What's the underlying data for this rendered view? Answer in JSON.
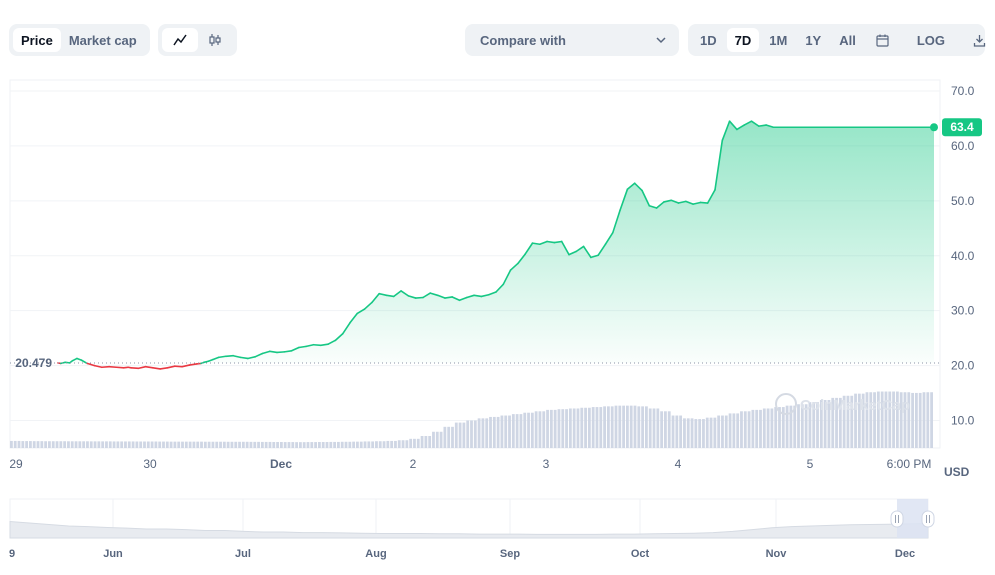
{
  "toolbar": {
    "data_tabs": [
      "Price",
      "Market cap"
    ],
    "active_data_tab": "Price",
    "chart_type_icons": [
      "line-chart-icon",
      "candlestick-icon"
    ],
    "compare_label": "Compare with",
    "ranges": [
      "1D",
      "7D",
      "1M",
      "1Y",
      "All"
    ],
    "active_range": "7D",
    "calendar_icon": "calendar-icon",
    "log_label": "LOG",
    "download_icon": "download-icon"
  },
  "colors": {
    "up": "#16c784",
    "down": "#ea3943",
    "volume": "#cfd6e4",
    "selector": "#dce3f2"
  },
  "watermark": "CoinMarketCap",
  "chart_data": {
    "type": "line",
    "currency": "USD",
    "ylim": [
      5,
      72
    ],
    "y_ticks": [
      "70.0",
      "60.0",
      "50.0",
      "40.0",
      "30.0",
      "20.0",
      "10.0"
    ],
    "x_tick_labels": [
      "29",
      "30",
      "Dec",
      "2",
      "3",
      "4",
      "5",
      "6:00 PM"
    ],
    "baseline": {
      "label": "20.479",
      "value": 20.479
    },
    "current": {
      "label": "63.4",
      "value": 63.4
    },
    "x": [
      0,
      0.02,
      0.05,
      0.08,
      0.1,
      0.13,
      0.16,
      0.2,
      0.25,
      0.3,
      0.35,
      0.4,
      0.45,
      0.48,
      0.5,
      0.55,
      0.6,
      0.65,
      0.7,
      0.75,
      0.8,
      0.85,
      0.9,
      0.95,
      0.98,
      1.0,
      1.03,
      1.06,
      1.1,
      1.15,
      1.2,
      1.25,
      1.3,
      1.35,
      1.4,
      1.45,
      1.5,
      1.55,
      1.6,
      1.65,
      1.7,
      1.75,
      1.8,
      1.85,
      1.9,
      1.95,
      2.0,
      2.05,
      2.1,
      2.15,
      2.2,
      2.25,
      2.3,
      2.35,
      2.4,
      2.45,
      2.5,
      2.55,
      2.6,
      2.65,
      2.7,
      2.75,
      2.8,
      2.85,
      2.9,
      2.95,
      3.0,
      3.05,
      3.1,
      3.15,
      3.2,
      3.25,
      3.3,
      3.35,
      3.4,
      3.45,
      3.5,
      3.55,
      3.6,
      3.65,
      3.7,
      3.75,
      3.8,
      3.85,
      3.9,
      3.95,
      4.0,
      4.05,
      4.1,
      4.15,
      4.2,
      4.25,
      4.3,
      4.35,
      4.4,
      4.45,
      4.5,
      4.55,
      4.6,
      4.65,
      4.7,
      4.75,
      4.8,
      4.85,
      4.9,
      4.95,
      5.0,
      5.05,
      5.1,
      5.15,
      5.2,
      5.25,
      5.3,
      5.35,
      5.4,
      5.45,
      5.5,
      5.55,
      5.6,
      5.65,
      5.7,
      5.75,
      5.8,
      5.85,
      5.9,
      5.95,
      6.0
    ],
    "y": [
      20.48,
      20.4,
      20.6,
      20.5,
      20.9,
      21.3,
      21.0,
      20.4,
      20.0,
      19.7,
      19.8,
      19.7,
      19.6,
      19.7,
      19.6,
      19.5,
      19.8,
      19.6,
      19.4,
      19.6,
      19.9,
      19.8,
      20.1,
      20.3,
      20.4,
      20.6,
      20.8,
      21.1,
      21.5,
      21.7,
      21.8,
      21.5,
      21.3,
      21.6,
      22.2,
      22.6,
      22.4,
      22.5,
      22.7,
      23.3,
      23.5,
      23.8,
      23.7,
      23.9,
      24.6,
      25.8,
      27.8,
      29.5,
      30.3,
      31.5,
      33.1,
      32.8,
      32.6,
      33.6,
      32.7,
      32.3,
      32.4,
      33.2,
      32.8,
      32.3,
      32.5,
      31.9,
      32.4,
      32.8,
      32.6,
      32.9,
      33.4,
      34.8,
      37.4,
      38.6,
      40.3,
      42.3,
      42.1,
      42.6,
      42.4,
      42.6,
      40.2,
      40.8,
      41.7,
      39.7,
      40.1,
      42.1,
      44.2,
      48.3,
      52.1,
      53.2,
      51.9,
      49.1,
      48.7,
      49.8,
      50.1,
      49.6,
      49.9,
      49.4,
      49.7,
      49.6,
      52.0,
      61.0,
      64.5,
      63.0,
      63.8,
      64.5,
      63.6,
      63.8,
      63.4,
      63.4,
      63.4,
      63.4,
      63.4,
      63.4,
      63.4,
      63.4,
      63.4,
      63.4,
      63.4,
      63.4,
      63.4,
      63.4,
      63.4,
      63.4,
      63.4,
      63.4,
      63.4,
      63.4,
      63.4,
      63.4,
      63.4
    ]
  },
  "volume_data": {
    "values": [
      1.0,
      0.98,
      0.97,
      0.96,
      0.96,
      0.95,
      0.95,
      0.94,
      0.94,
      0.93,
      0.93,
      0.92,
      0.92,
      0.91,
      0.9,
      0.9,
      0.9,
      0.89,
      0.89,
      0.88,
      0.88,
      0.87,
      0.86,
      0.85,
      0.84,
      0.83,
      0.84,
      0.85,
      0.86,
      0.88,
      0.9,
      0.93,
      0.96,
      1.0,
      1.1,
      1.3,
      1.7,
      2.3,
      3.0,
      3.6,
      3.9,
      4.2,
      4.4,
      4.6,
      4.8,
      5.0,
      5.2,
      5.4,
      5.5,
      5.6,
      5.7,
      5.8,
      5.9,
      6.0,
      6.0,
      5.9,
      5.6,
      5.2,
      4.6,
      4.2,
      4.1,
      4.3,
      4.6,
      4.9,
      5.2,
      5.4,
      5.6,
      5.8,
      6.0,
      6.2,
      6.5,
      6.8,
      7.1,
      7.4,
      7.7,
      7.9,
      8.0,
      8.0,
      7.9,
      7.8,
      7.9
    ]
  },
  "navigator": {
    "labels": [
      "9",
      "Jun",
      "Jul",
      "Aug",
      "Sep",
      "Oct",
      "Nov",
      "Dec"
    ],
    "values": [
      0.55,
      0.5,
      0.45,
      0.4,
      0.38,
      0.35,
      0.33,
      0.3,
      0.3,
      0.28,
      0.25,
      0.25,
      0.22,
      0.2,
      0.2,
      0.18,
      0.18,
      0.17,
      0.16,
      0.15,
      0.15,
      0.15,
      0.14,
      0.14,
      0.13,
      0.13,
      0.13,
      0.12,
      0.12,
      0.12,
      0.12,
      0.13,
      0.13,
      0.14,
      0.15,
      0.16,
      0.18,
      0.22,
      0.28,
      0.34,
      0.38,
      0.4,
      0.42,
      0.44,
      0.45,
      0.46,
      0.47,
      0.48
    ]
  }
}
